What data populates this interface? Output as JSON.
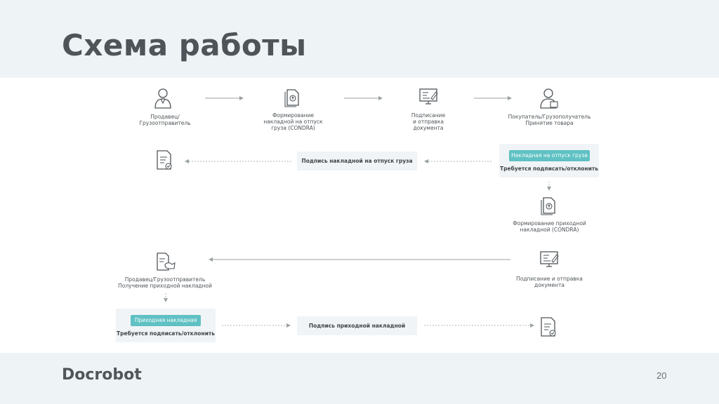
{
  "slide": {
    "title": "Схема работы",
    "logo": "Docrobot",
    "page_number": "20"
  },
  "diagram": {
    "nodes": {
      "seller": "Продавец/\nГрузоотправитель",
      "form_invoice": "Формирование\nнакладной на отпуск\nгруза (CONDRA)",
      "sign_send_1": "Подписание\nи отправка\nдокумента",
      "buyer": "Покупатель/Грузополучатель\nПринятие товара",
      "form_receipt": "Формирование приходной\nнакладной (CONDRA)",
      "sign_send_2": "Подписание и отправка\nдокумента",
      "seller_receive": "Продавец/Грузоотправитель\nПолучение приходной накладной"
    },
    "panels": {
      "outgoing_pill": "Накладная на отпуск груза",
      "outgoing_req": "Требуется подписать/отклонить",
      "incoming_pill": "Приходная накладная",
      "incoming_req": "Требуется подписать/отклонить"
    },
    "boxes": {
      "sign_outgoing": "Подпись накладной на отпуск груза",
      "sign_incoming": "Подпись приходной накладной"
    }
  },
  "icons": {
    "person": "person-icon",
    "document": "document-upload-icon",
    "monitor": "monitor-sign-icon",
    "signed_doc": "signed-document-icon",
    "stamp_doc": "stamp-document-icon"
  }
}
